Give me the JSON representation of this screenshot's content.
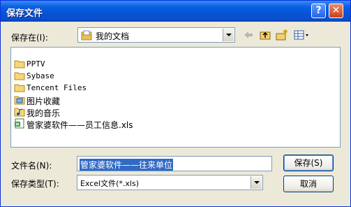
{
  "window": {
    "title": "保存文件",
    "help_label": "?",
    "close_label": "✕"
  },
  "lookin": {
    "label": "保存在(I):",
    "value": "我的文档",
    "icon": "my-documents-icon"
  },
  "toolbar": [
    "back-arrow-icon",
    "up-folder-icon",
    "new-folder-icon",
    "view-menu-icon"
  ],
  "files": [
    {
      "name": "PPTV",
      "icon": "folder-icon"
    },
    {
      "name": "Sybase",
      "icon": "folder-icon"
    },
    {
      "name": "Tencent Files",
      "icon": "folder-icon"
    },
    {
      "name": "图片收藏",
      "icon": "pictures-folder-icon"
    },
    {
      "name": "我的音乐",
      "icon": "music-folder-icon"
    },
    {
      "name": "管家婆软件——员工信息.xls",
      "icon": "excel-file-icon"
    }
  ],
  "filename": {
    "label": "文件名(N):",
    "value": "管家婆软件——往来单位"
  },
  "filetype": {
    "label": "保存类型(T):",
    "value": "Excel文件(*.xls)"
  },
  "buttons": {
    "save": "保存(S)",
    "cancel": "取消"
  }
}
